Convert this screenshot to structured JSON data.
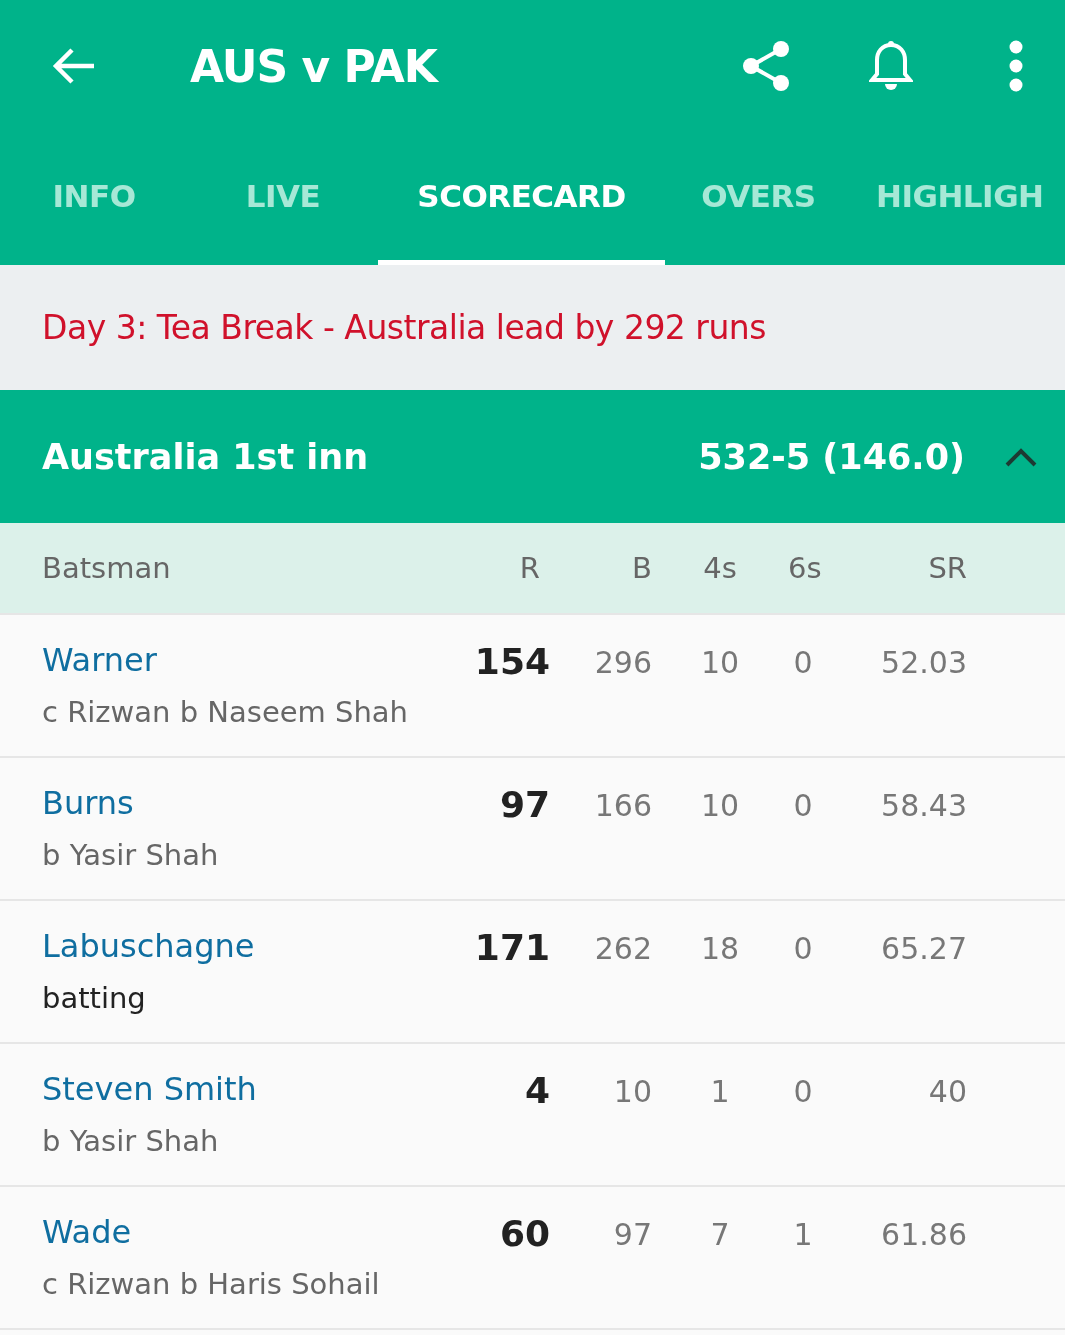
{
  "app_bar": {
    "title": "AUS v PAK"
  },
  "tabs": [
    {
      "label": "INFO",
      "selected": false
    },
    {
      "label": "LIVE",
      "selected": false
    },
    {
      "label": "SCORECARD",
      "selected": true
    },
    {
      "label": "OVERS",
      "selected": false
    },
    {
      "label": "HIGHLIGH",
      "selected": false
    }
  ],
  "status": "Day 3: Tea Break - Australia lead by 292 runs",
  "innings": {
    "title": "Australia 1st inn",
    "score": "532-5 (146.0)",
    "expanded": true
  },
  "columns": [
    "Batsman",
    "R",
    "B",
    "4s",
    "6s",
    "SR"
  ],
  "rows": [
    {
      "name": "Warner",
      "dismissal": "c Rizwan b Naseem Shah",
      "batting": false,
      "r": "154",
      "b": "296",
      "fours": "10",
      "sixes": "0",
      "sr": "52.03"
    },
    {
      "name": "Burns",
      "dismissal": "b Yasir Shah",
      "batting": false,
      "r": "97",
      "b": "166",
      "fours": "10",
      "sixes": "0",
      "sr": "58.43"
    },
    {
      "name": "Labuschagne",
      "dismissal": "batting",
      "batting": true,
      "r": "171",
      "b": "262",
      "fours": "18",
      "sixes": "0",
      "sr": "65.27"
    },
    {
      "name": "Steven Smith",
      "dismissal": "b Yasir Shah",
      "batting": false,
      "r": "4",
      "b": "10",
      "fours": "1",
      "sixes": "0",
      "sr": "40"
    },
    {
      "name": "Wade",
      "dismissal": "c Rizwan b Haris Sohail",
      "batting": false,
      "r": "60",
      "b": "97",
      "fours": "7",
      "sixes": "1",
      "sr": "61.86"
    }
  ]
}
